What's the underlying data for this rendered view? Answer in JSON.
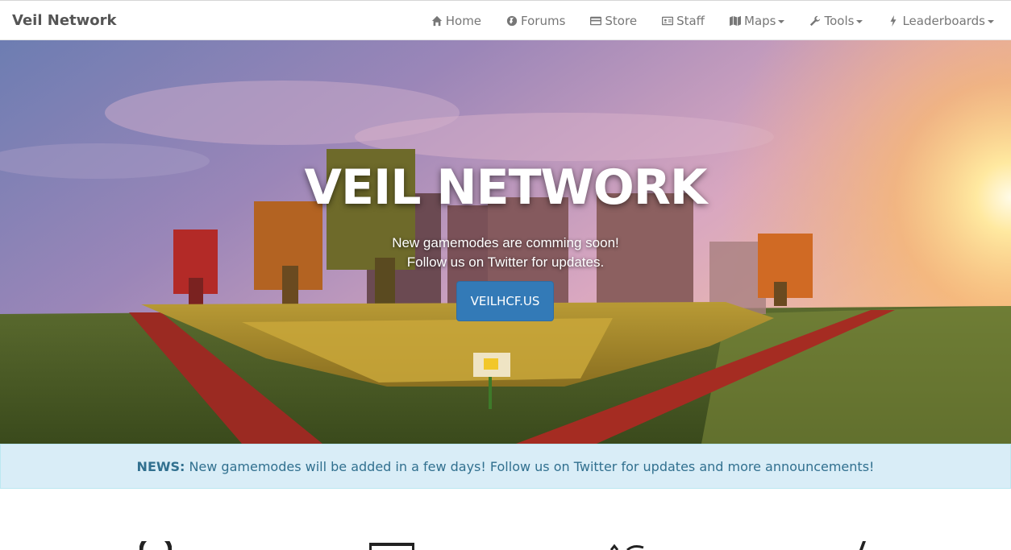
{
  "navbar": {
    "brand": "Veil Network",
    "items": [
      {
        "label": "Home",
        "icon": "home-icon"
      },
      {
        "label": "Forums",
        "icon": "globe-icon"
      },
      {
        "label": "Store",
        "icon": "credit-card-icon"
      },
      {
        "label": "Staff",
        "icon": "id-card-icon"
      },
      {
        "label": "Maps",
        "icon": "map-icon",
        "dropdown": true
      },
      {
        "label": "Tools",
        "icon": "wrench-icon",
        "dropdown": true
      },
      {
        "label": "Leaderboards",
        "icon": "bolt-icon",
        "dropdown": true
      }
    ]
  },
  "hero": {
    "title": "VEIL NETWORK",
    "subtitle_line1": "New gamemodes are comming soon!",
    "subtitle_line2": "Follow us on Twitter for updates.",
    "button_label": "VEILHCF.US"
  },
  "news": {
    "label": "NEWS:",
    "text": "New gamemodes will be added in a few days! Follow us on Twitter for updates and more announcements!"
  },
  "colors": {
    "primary_button": "#337ab7",
    "news_bg": "#d9edf7",
    "news_text": "#31708f"
  }
}
